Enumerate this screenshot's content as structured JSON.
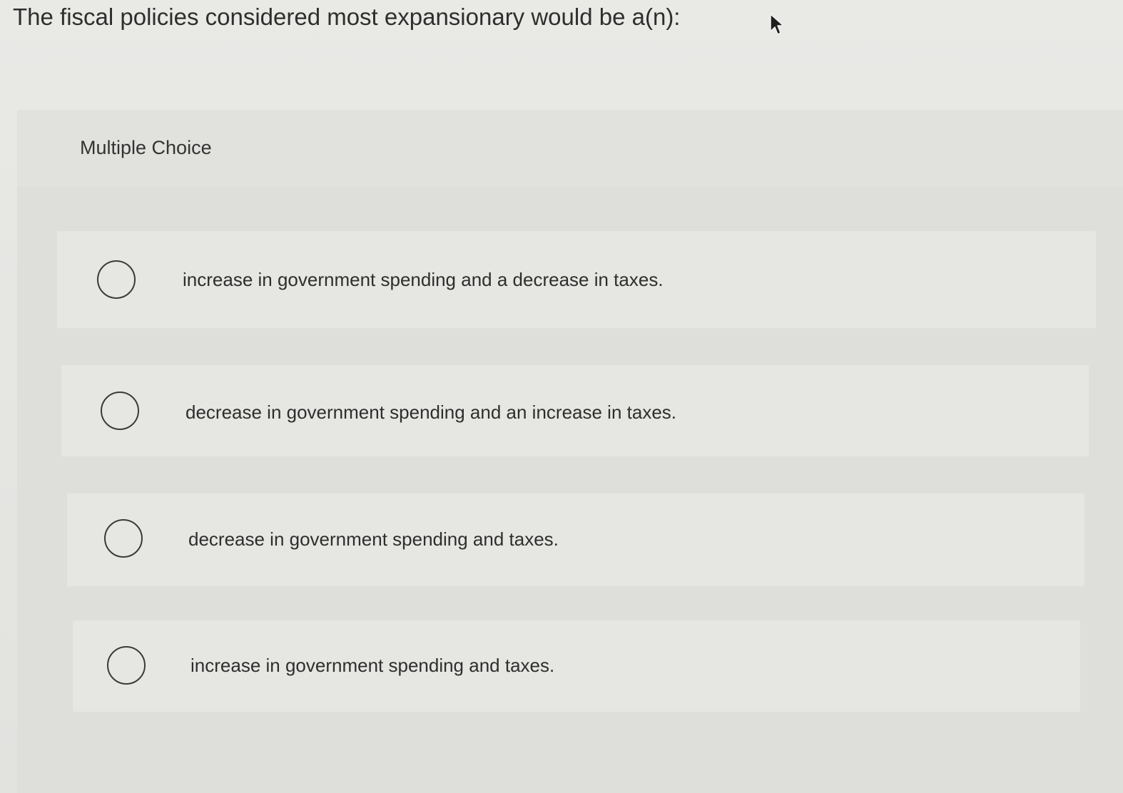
{
  "question": {
    "text": "The fiscal policies considered most expansionary would be a(n):"
  },
  "cursor": {
    "icon": "arrow-cursor-icon"
  },
  "panel": {
    "label": "Multiple Choice",
    "options": [
      {
        "label": "increase in government spending and a decrease in taxes.",
        "selected": false
      },
      {
        "label": "decrease in government spending and an increase in taxes.",
        "selected": false
      },
      {
        "label": "decrease in government spending and taxes.",
        "selected": false
      },
      {
        "label": "increase in government spending and taxes.",
        "selected": false
      }
    ]
  },
  "colors": {
    "background": "#e6e6e3",
    "panel": "#dededb",
    "text": "#2e2e2e"
  }
}
